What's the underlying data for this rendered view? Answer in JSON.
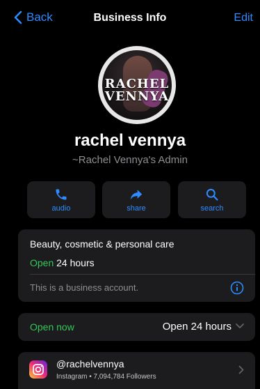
{
  "nav": {
    "back_label": "Back",
    "title": "Business Info",
    "edit_label": "Edit"
  },
  "profile": {
    "avatar_text_line1": "RACHEL",
    "avatar_text_line2": "VENNYA",
    "name": "rachel vennya",
    "subtitle": "~Rachel Vennya's Admin"
  },
  "actions": [
    {
      "label": "audio",
      "icon": "phone-icon"
    },
    {
      "label": "share",
      "icon": "share-arrow-icon"
    },
    {
      "label": "search",
      "icon": "search-icon"
    }
  ],
  "business": {
    "category": "Beauty, cosmetic & personal care",
    "hours_status": "Open",
    "hours_text": "24 hours",
    "note": "This is a business account."
  },
  "hours": {
    "status": "Open now",
    "value": "Open 24 hours"
  },
  "instagram": {
    "handle": "@rachelvennya",
    "meta": "Instagram • 7,094,784 Followers"
  },
  "colors": {
    "accent": "#2f8cff",
    "open_green": "#34c759",
    "card_bg": "#1c1c1e"
  }
}
